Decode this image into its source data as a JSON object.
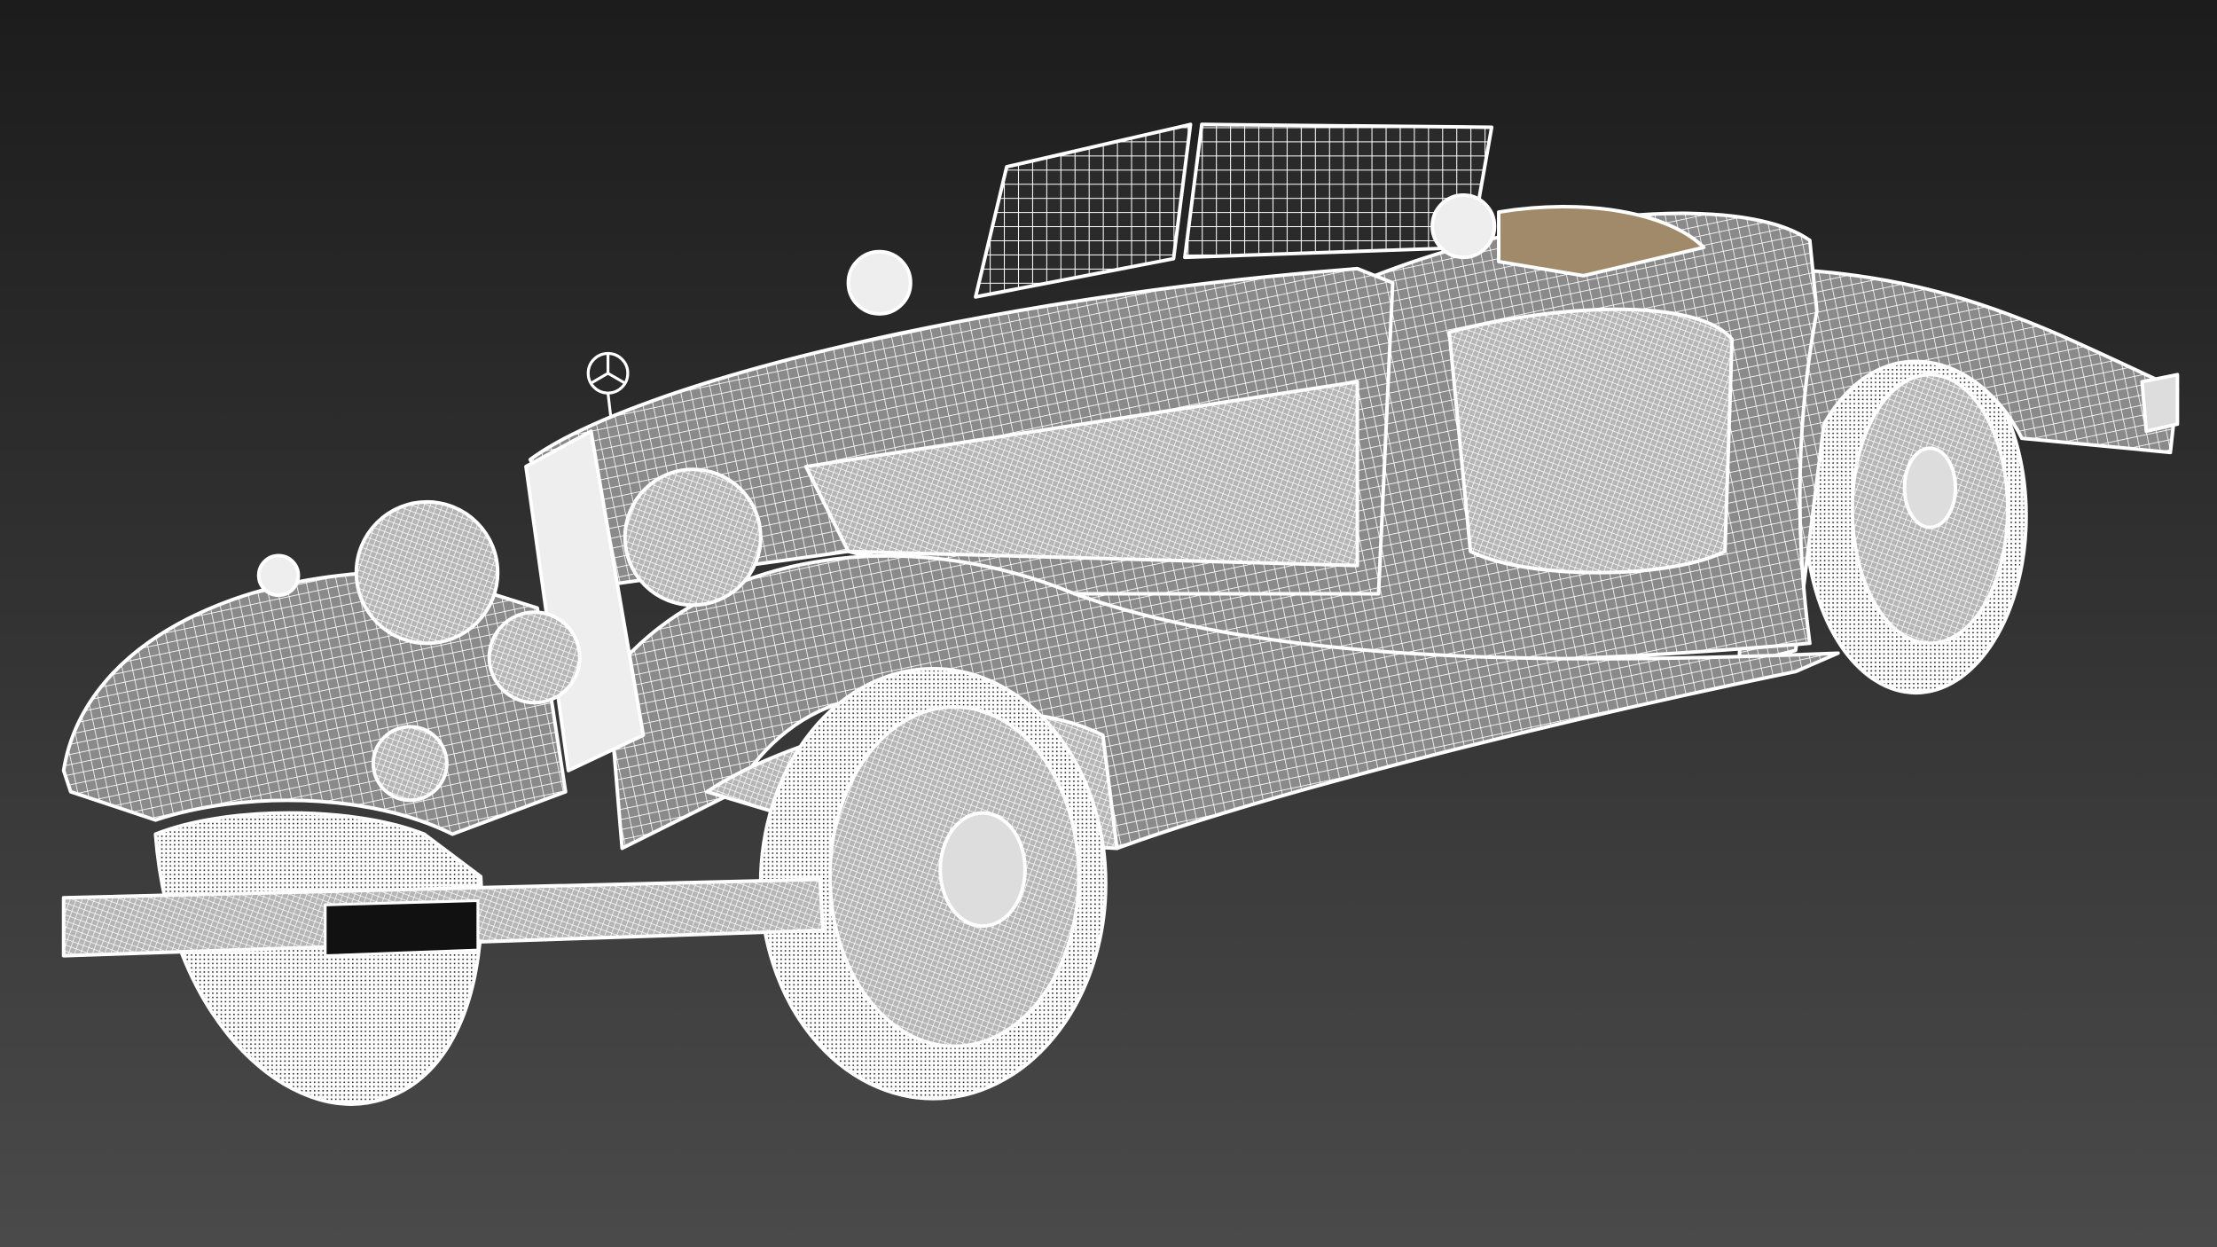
{
  "scene": {
    "background_top": "#1c1c1c",
    "background_bottom": "#4a4a4a",
    "wire_color": "#ffffff",
    "surface_color": "#8a8a8a",
    "interior_color": "#a08a6a",
    "plate_color": "#111111"
  }
}
